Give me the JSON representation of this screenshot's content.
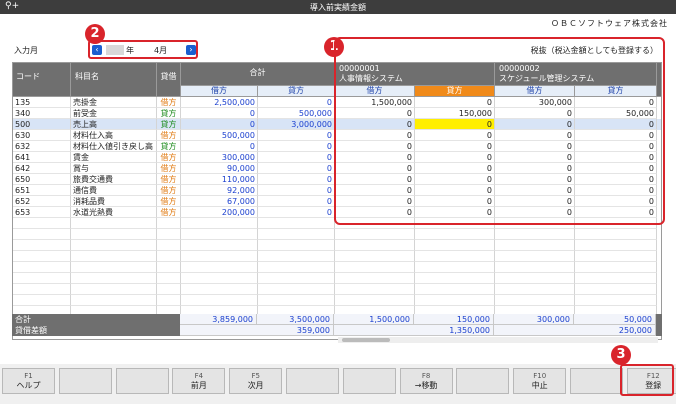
{
  "window": {
    "title": "導入前実績金額"
  },
  "company": "ＯＢＣソフトウェア株式会社",
  "month": {
    "label": "入力月",
    "year_suffix": "年",
    "value": "4月"
  },
  "tax_note": "税抜（税込金額としても登録する）",
  "callouts": [
    "1",
    "2",
    "3"
  ],
  "columns": {
    "code": "コード",
    "name": "科目名",
    "dc": "貸借",
    "total": "合計",
    "debit": "借方",
    "credit": "貸方"
  },
  "systems": [
    {
      "code": "00000001",
      "name": "人事情報システム"
    },
    {
      "code": "00000002",
      "name": "スケジュール管理システム"
    }
  ],
  "rows": [
    {
      "code": "135",
      "name": "売掛金",
      "dc": "借方",
      "tdeb": "2,500,000",
      "tcred": "0",
      "s1d": "1,500,000",
      "s1c": "0",
      "s2d": "300,000",
      "s2c": "0"
    },
    {
      "code": "340",
      "name": "前受金",
      "dc": "貸方",
      "tdeb": "0",
      "tcred": "500,000",
      "s1d": "0",
      "s1c": "150,000",
      "s2d": "0",
      "s2c": "50,000"
    },
    {
      "code": "500",
      "name": "売上高",
      "dc": "貸方",
      "tdeb": "0",
      "tcred": "3,000,000",
      "s1d": "0",
      "s1c": "0",
      "s2d": "0",
      "s2c": "0"
    },
    {
      "code": "630",
      "name": "材料仕入高",
      "dc": "借方",
      "tdeb": "500,000",
      "tcred": "0",
      "s1d": "0",
      "s1c": "0",
      "s2d": "0",
      "s2c": "0"
    },
    {
      "code": "632",
      "name": "材料仕入値引き戻し高",
      "dc": "貸方",
      "tdeb": "0",
      "tcred": "0",
      "s1d": "0",
      "s1c": "0",
      "s2d": "0",
      "s2c": "0"
    },
    {
      "code": "641",
      "name": "賃金",
      "dc": "借方",
      "tdeb": "300,000",
      "tcred": "0",
      "s1d": "0",
      "s1c": "0",
      "s2d": "0",
      "s2c": "0"
    },
    {
      "code": "642",
      "name": "賞与",
      "dc": "借方",
      "tdeb": "90,000",
      "tcred": "0",
      "s1d": "0",
      "s1c": "0",
      "s2d": "0",
      "s2c": "0"
    },
    {
      "code": "650",
      "name": "旅費交通費",
      "dc": "借方",
      "tdeb": "110,000",
      "tcred": "0",
      "s1d": "0",
      "s1c": "0",
      "s2d": "0",
      "s2c": "0"
    },
    {
      "code": "651",
      "name": "通信費",
      "dc": "借方",
      "tdeb": "92,000",
      "tcred": "0",
      "s1d": "0",
      "s1c": "0",
      "s2d": "0",
      "s2c": "0"
    },
    {
      "code": "652",
      "name": "消耗品費",
      "dc": "借方",
      "tdeb": "67,000",
      "tcred": "0",
      "s1d": "0",
      "s1c": "0",
      "s2d": "0",
      "s2c": "0"
    },
    {
      "code": "653",
      "name": "水道光熱費",
      "dc": "借方",
      "tdeb": "200,000",
      "tcred": "0",
      "s1d": "0",
      "s1c": "0",
      "s2d": "0",
      "s2c": "0"
    }
  ],
  "totals": {
    "label": "合計",
    "values": [
      "3,859,000",
      "3,500,000",
      "1,500,000",
      "150,000",
      "300,000",
      "50,000"
    ]
  },
  "diff": {
    "label": "貸借差額",
    "values": [
      "359,000",
      "1,350,000",
      "250,000"
    ]
  },
  "fkeys": [
    {
      "key": "F1",
      "label": "ヘルプ"
    },
    {
      "key": "",
      "label": ""
    },
    {
      "key": "",
      "label": ""
    },
    {
      "key": "F4",
      "label": "前月"
    },
    {
      "key": "F5",
      "label": "次月"
    },
    {
      "key": "",
      "label": ""
    },
    {
      "key": "",
      "label": ""
    },
    {
      "key": "F8",
      "label": "→移動"
    },
    {
      "key": "",
      "label": ""
    },
    {
      "key": "F10",
      "label": "中止"
    },
    {
      "key": "",
      "label": ""
    },
    {
      "key": "F12",
      "label": "登録"
    }
  ]
}
